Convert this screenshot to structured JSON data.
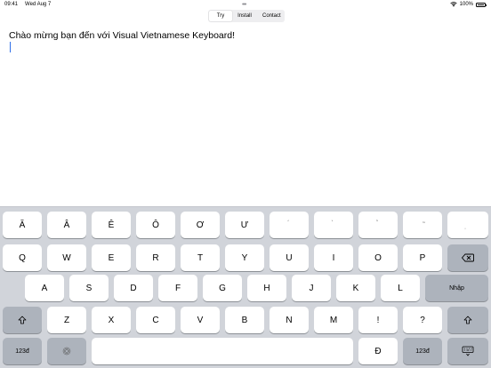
{
  "status_bar": {
    "time": "09:41",
    "date": "Wed Aug 7",
    "battery": "100%",
    "more": "•••"
  },
  "segments": [
    {
      "label": "Try",
      "active": true
    },
    {
      "label": "Install",
      "active": false
    },
    {
      "label": "Contact",
      "active": false
    }
  ],
  "text_area": {
    "text": "Chào mừng bạn đến với Visual Vietnamese Keyboard!"
  },
  "keyboard": {
    "row1": [
      "Ă",
      "Â",
      "Ê",
      "Ô",
      "Ơ",
      "Ư",
      "́",
      "̀",
      "̉",
      "̃",
      "̣"
    ],
    "row2": [
      "Q",
      "W",
      "E",
      "R",
      "T",
      "Y",
      "U",
      "I",
      "O",
      "P"
    ],
    "backspace_icon": "backspace-icon",
    "row3": [
      "A",
      "S",
      "D",
      "F",
      "G",
      "H",
      "J",
      "K",
      "L"
    ],
    "enter_label": "Nhập",
    "shift_icon": "shift-icon",
    "row4": [
      "Z",
      "X",
      "C",
      "V",
      "B",
      "N",
      "M",
      "!",
      "?"
    ],
    "numbers_label": "123đ",
    "globe_icon": "fingerprint-icon",
    "d_key": "Đ",
    "hide_icon": "keyboard-hide-icon"
  }
}
